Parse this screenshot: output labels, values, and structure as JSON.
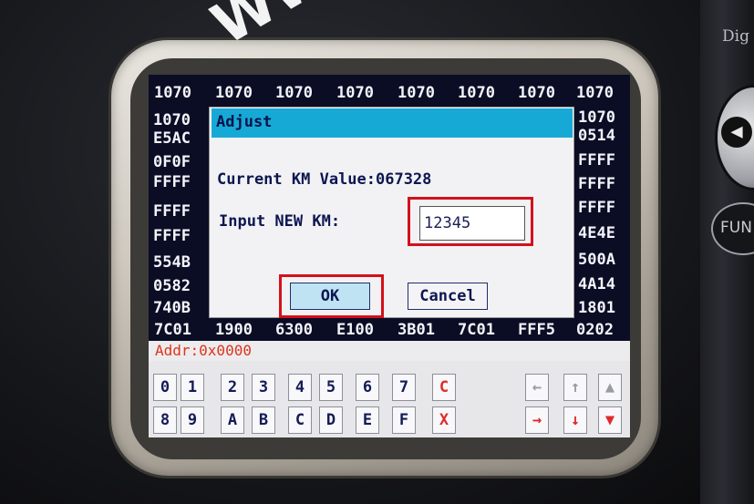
{
  "watermark": "WW",
  "device": {
    "brand_text": "Dig",
    "fun_label": "FUN",
    "nav_glyph": "◀"
  },
  "hex_grid": {
    "top_row": [
      "1070",
      "1070",
      "1070",
      "1070",
      "1070",
      "1070",
      "1070",
      "1070"
    ],
    "left_column": [
      "1070",
      "E5AC",
      "0F0F",
      "FFFF",
      "FFFF",
      "FFFF",
      "554B",
      "0582",
      "740B"
    ],
    "right_column": [
      "1070",
      "0514",
      "FFFF",
      "FFFF",
      "FFFF",
      "4E4E",
      "500A",
      "4A14",
      "1801"
    ],
    "bottom_row": [
      "7C01",
      "1900",
      "6300",
      "E100",
      "3B01",
      "7C01",
      "FFF5",
      "0202"
    ]
  },
  "dialog": {
    "title": "Adjust",
    "current_km": "Current KM Value:067328",
    "input_label": "Input NEW KM:",
    "input_value": "12345",
    "ok_label": "OK",
    "cancel_label": "Cancel"
  },
  "address": "Addr:0x0000",
  "keypad": {
    "row1": [
      "0",
      "1",
      "2",
      "3",
      "4",
      "5",
      "6",
      "7",
      "C"
    ],
    "row2": [
      "8",
      "9",
      "A",
      "B",
      "C",
      "D",
      "E",
      "F",
      "X"
    ],
    "nav_row1": [
      "←",
      "↑",
      "▲"
    ],
    "nav_row2": [
      "→",
      "↓",
      "▼"
    ]
  },
  "colors": {
    "screen_bg": "#0b0d24",
    "title_bar": "#16a9d6",
    "highlight_red": "#d4101a",
    "addr_text": "#e0331b"
  }
}
